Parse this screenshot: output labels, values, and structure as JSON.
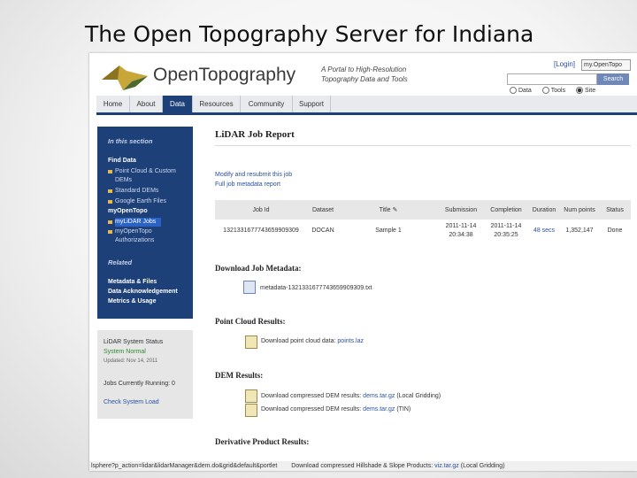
{
  "slide_title": "The Open Topography Server for Indiana",
  "header": {
    "brand": "OpenTopography",
    "tagline": "A Portal to High-Resolution Topography Data and Tools",
    "login": "[Login]",
    "my_opentopo": "my.OpenTopo",
    "search_button": "Search",
    "search_options": [
      {
        "label": "Data",
        "selected": false
      },
      {
        "label": "Tools",
        "selected": false
      },
      {
        "label": "Site",
        "selected": true
      }
    ]
  },
  "nav": {
    "tabs": [
      "Home",
      "About",
      "Data",
      "Resources",
      "Community",
      "Support"
    ],
    "active": "Data"
  },
  "sidebar": {
    "section_heading": "In this section",
    "find_data": "Find Data",
    "items": [
      "Point Cloud & Custom DEMs",
      "Standard DEMs",
      "Google Earth Files"
    ],
    "my_opentopo": "myOpenTopo",
    "my_items": [
      "myLiDAR Jobs",
      "myOpenTopo Authorizations"
    ],
    "related_heading": "Related",
    "related_items": [
      "Metadata & Files",
      "Data Acknowledgement",
      "Metrics & Usage"
    ]
  },
  "system_status": {
    "title": "LiDAR System Status",
    "status": "System Normal",
    "updated": "Updated: Nov 14, 2011",
    "jobs_running": "Jobs Currently Running: 0",
    "check_link": "Check System Load"
  },
  "report": {
    "title": "LiDAR Job Report",
    "modify_link": "Modify and resubmit this job",
    "metadata_link": "Full job metadata report",
    "table": {
      "headers": [
        "Job Id",
        "Dataset",
        "Title",
        "Submission",
        "Completion",
        "Duration",
        "Num points",
        "Status"
      ],
      "row": [
        "1321331677743659909309",
        "DOCAN",
        "Sample 1",
        "2011-11-14 20:34:38",
        "2011-11-14 20:35:25",
        "48 secs",
        "1,352,147",
        "Done"
      ]
    },
    "download_metadata_heading": "Download Job Metadata:",
    "metadata_file": "metadata-1321331677743659909309.txt",
    "point_cloud_heading": "Point Cloud Results:",
    "point_cloud_text": "Download point cloud data:",
    "point_cloud_link": "points.laz",
    "dem_heading": "DEM Results:",
    "dem_lines": [
      {
        "text": "Download compressed DEM results:",
        "link": "dems.tar.gz",
        "suffix": "(Local Gridding)"
      },
      {
        "text": "Download compressed DEM results:",
        "link": "dems.tar.gz",
        "suffix": "(TIN)"
      }
    ],
    "derivative_heading": "Derivative Product Results:",
    "derivative_text": "Download compressed Hillshade & Slope Products:",
    "derivative_link": "viz.tar.gz",
    "derivative_suffix": "(Local Gridding)"
  },
  "status_bar": "lsphere?p_action=lidar&lidarManager&dem.do&grid&default&portlet"
}
